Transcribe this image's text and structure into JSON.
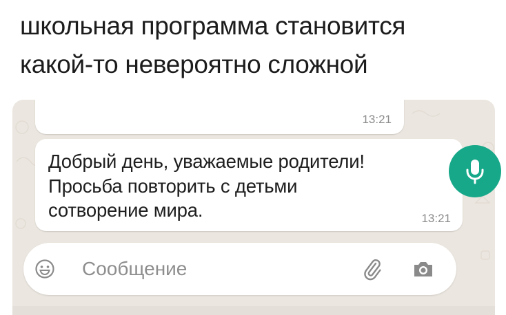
{
  "caption": {
    "line1": "школьная программа становится",
    "line2": "какой-то невероятно сложной"
  },
  "chat": {
    "previous_message": {
      "time": "13:21"
    },
    "message": {
      "lines": [
        "Добрый день, уважаемые родители!",
        "Просьба повторить с детьми",
        "сотворение мира."
      ],
      "time": "13:21"
    },
    "input": {
      "placeholder": "Сообщение"
    },
    "icons": {
      "emoji": "emoji-icon",
      "attach": "paperclip-icon",
      "camera": "camera-icon",
      "mic": "microphone-icon"
    },
    "colors": {
      "background": "#ebe6df",
      "bubble": "#ffffff",
      "accent": "#17a889",
      "timestamp": "#8b8b8b"
    }
  }
}
